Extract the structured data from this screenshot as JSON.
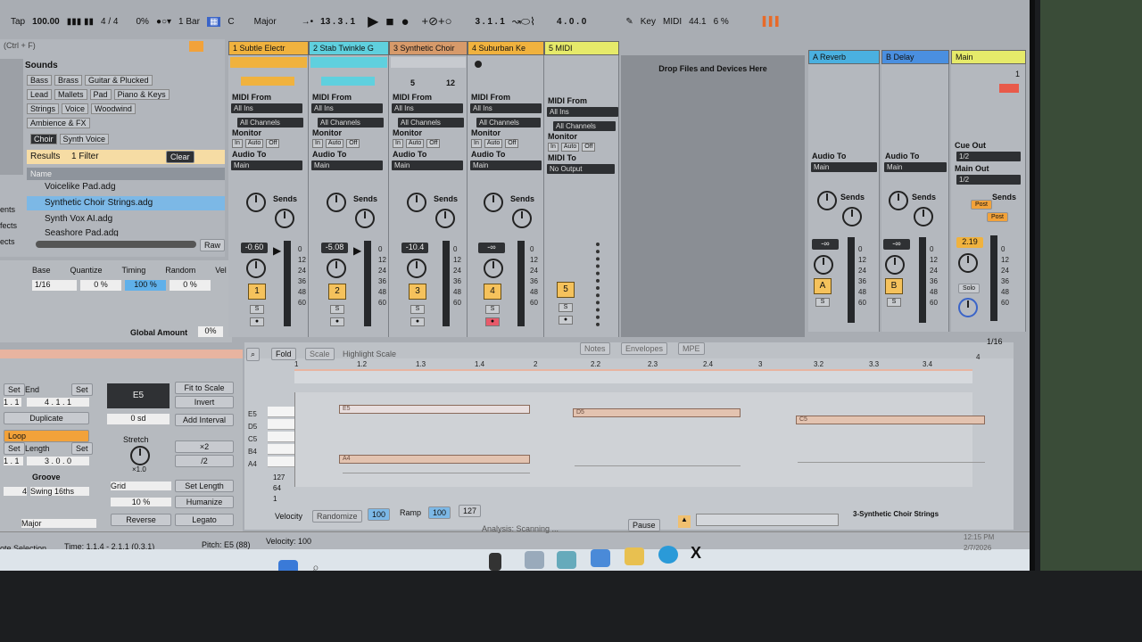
{
  "transport": {
    "tap": "Tap",
    "tempo": "100.00",
    "signature": "4 / 4",
    "swing": "0%",
    "quantize": "1 Bar",
    "key_root": "C",
    "key_scale": "Major",
    "arrangement_pos": "13 .  3 .  1",
    "loop_start": "3 .  1 .  1",
    "loop_length": "4 .  0 .  0",
    "key_label": "Key",
    "midi_label": "MIDI",
    "sample_rate": "44.1",
    "cpu": "6 %"
  },
  "browser": {
    "search": "(Ctrl + F)",
    "sounds_label": "Sounds",
    "tags_row1": [
      "Bass",
      "Brass",
      "Guitar & Plucked"
    ],
    "tags_row2": [
      "Lead",
      "Mallets",
      "Pad",
      "Piano & Keys"
    ],
    "tags_row3": [
      "Strings",
      "Voice",
      "Woodwind"
    ],
    "tags_row4": [
      "Ambience & FX"
    ],
    "subtags": [
      "Choir",
      "Synth Voice"
    ],
    "results_label": "Results",
    "filter_label": "1 Filter",
    "clear_label": "Clear",
    "name_header": "Name",
    "items": [
      "Voicelike Pad.adg",
      "Synthetic Choir Strings.adg",
      "Synth Vox AI.adg",
      "Seashore Pad.adg"
    ],
    "side_labels": [
      "ents",
      "fects",
      "ects"
    ],
    "raw_label": "Raw"
  },
  "clip_props": {
    "headers": [
      "Base",
      "Quantize",
      "Timing",
      "Random",
      "Vel"
    ],
    "values": [
      "1/16",
      "0 %",
      "100 %",
      "0 %"
    ],
    "global_amount_label": "Global Amount",
    "global_amount": "0%"
  },
  "tracks": [
    {
      "name": "1 Subtle Electr",
      "color": "#f0b23e",
      "num": "1",
      "vol": "-0.60",
      "in": "MIDI From",
      "src": "All Ins",
      "ch": "All Channels",
      "mon": "Monitor",
      "out_label": "Audio To",
      "out": "Main"
    },
    {
      "name": "2 Stab Twinkle G",
      "color": "#5fd0de",
      "num": "2",
      "vol": "-5.08",
      "in": "MIDI From",
      "src": "All Ins",
      "ch": "All Channels",
      "mon": "Monitor",
      "out_label": "Audio To",
      "out": "Main"
    },
    {
      "name": "3 Synthetic Choir",
      "color": "#d79a6a",
      "num": "3",
      "vol": "-10.4",
      "in": "MIDI From",
      "src": "All Ins",
      "ch": "All Channels",
      "mon": "Monitor",
      "out_label": "Audio To",
      "out": "Main"
    },
    {
      "name": "4 Suburban Ke",
      "color": "#f0b23e",
      "num": "4",
      "vol": "-∞",
      "in": "MIDI From",
      "src": "All Ins",
      "ch": "All Channels",
      "mon": "Monitor",
      "out_label": "Audio To",
      "out": "Main"
    },
    {
      "name": "5 MIDI",
      "color": "#e6ea6a",
      "num": "5",
      "vol": "",
      "in": "MIDI From",
      "src": "All Ins",
      "ch": "All Channels",
      "mon": "Monitor",
      "out_label": "MIDI To",
      "out": "No Output"
    }
  ],
  "monitor_opts": [
    "In",
    "Auto",
    "Off"
  ],
  "sends_label": "Sends",
  "clip_counts": [
    "5",
    "12"
  ],
  "drop_zone": "Drop Files and Devices Here",
  "returns": [
    {
      "name": "A Reverb",
      "color": "#4ab0e0",
      "letter": "A",
      "vol": "-∞",
      "out_label": "Audio To",
      "out": "Main"
    },
    {
      "name": "B Delay",
      "color": "#4a8fe0",
      "letter": "B",
      "vol": "-∞",
      "out_label": "Audio To",
      "out": "Main"
    }
  ],
  "master": {
    "name": "Main",
    "color": "#e6ea6a",
    "vol": "2.19",
    "cue_label": "Cue Out",
    "cue": "1/2",
    "main_label": "Main Out",
    "main": "1/2",
    "post": "Post",
    "solo": "Solo",
    "num": "1"
  },
  "meter_scale": [
    "0",
    "12",
    "24",
    "36",
    "48",
    "60"
  ],
  "editor": {
    "fold": "Fold",
    "scale": "Scale",
    "highlight": "Highlight Scale",
    "tabs": [
      "Notes",
      "Envelopes",
      "MPE"
    ],
    "grid_value": "1/16",
    "ruler": [
      "1",
      "1.2",
      "1.3",
      "1.4",
      "2",
      "2.2",
      "2.3",
      "2.4",
      "3",
      "3.2",
      "3.3",
      "3.4",
      "4"
    ],
    "keys": [
      "E5",
      "D5",
      "C5",
      "B4",
      "A4"
    ],
    "notes": [
      {
        "label": "E5"
      },
      {
        "label": "D5"
      },
      {
        "label": "C5"
      },
      {
        "label": "A4"
      }
    ],
    "velocity_scale": [
      "127",
      "64",
      "1"
    ],
    "velocity_label": "Velocity",
    "randomize": "Randomize",
    "vel_value": "100",
    "ramp": "Ramp",
    "ramp_a": "100",
    "ramp_b": "127"
  },
  "note_tools": {
    "set": "Set",
    "end": "End",
    "start_val": "1 .  1",
    "end_val": "4 .  1 .  1",
    "duplicate": "Duplicate",
    "loop": "Loop",
    "length_label": "Length",
    "length_start": "1 .  1",
    "length_val": "3 .  0 .  0",
    "groove_label": "Groove",
    "groove_val": "4",
    "swing": "Swing 16ths",
    "scale_val": "Major",
    "pitch_box": "E5",
    "pitch_sub": "0 sd",
    "fit": "Fit to Scale",
    "invert": "Invert",
    "add_interval": "Add Interval",
    "stretch": "Stretch",
    "stretch_val": "×1.0",
    "x2": "×2",
    "half": "/2",
    "grid": "Grid",
    "grid_pct": "10 %",
    "set_length": "Set Length",
    "humanize": "Humanize",
    "reverse": "Reverse",
    "legato": "Legato"
  },
  "status": {
    "left": "ote Selection",
    "time": "Time: 1.1.4 - 2.1.1 (0.3.1)",
    "pitch": "Pitch: E5 (88)",
    "velocity": "Velocity: 100",
    "analysis": "Analysis: Scanning ...",
    "pause": "Pause",
    "track": "3-Synthetic Choir Strings"
  },
  "taskbar": {
    "time": "12:15 PM",
    "date": "2/7/2026"
  }
}
